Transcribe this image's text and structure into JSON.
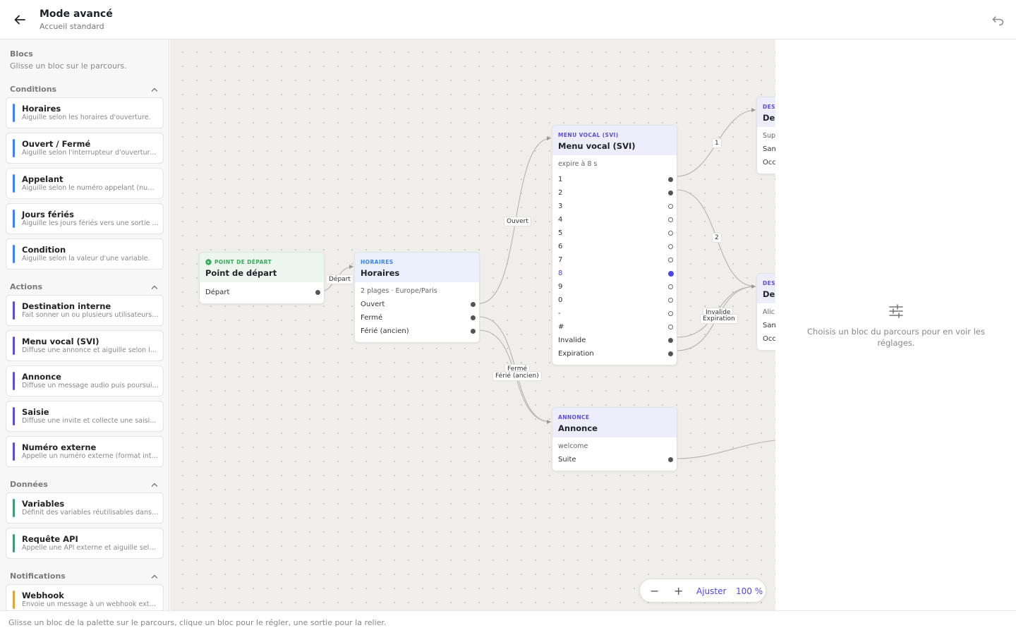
{
  "header": {
    "title": "Mode avancé",
    "subtitle": "Accueil standard"
  },
  "sidebar": {
    "title": "Blocs",
    "subtitle": "Glisse un bloc sur le parcours.",
    "sections": [
      {
        "label": "Conditions",
        "color": "#3b82f6",
        "items": [
          {
            "title": "Horaires",
            "desc": "Aiguille selon les horaires d'ouverture."
          },
          {
            "title": "Ouvert / Fermé",
            "desc": "Aiguille selon l'interrupteur d'ouverture manuel."
          },
          {
            "title": "Appelant",
            "desc": "Aiguille selon le numéro appelant (numéro ou préfixe)."
          },
          {
            "title": "Jours fériés",
            "desc": "Aiguille les jours fériés vers une sortie dédiée."
          },
          {
            "title": "Condition",
            "desc": "Aiguille selon la valeur d'une variable."
          }
        ]
      },
      {
        "label": "Actions",
        "color": "#5b4fd6",
        "items": [
          {
            "title": "Destination interne",
            "desc": "Fait sonner un ou plusieurs utilisateurs ou groupes."
          },
          {
            "title": "Menu vocal (SVI)",
            "desc": "Diffuse une annonce et aiguille selon la touche."
          },
          {
            "title": "Annonce",
            "desc": "Diffuse un message audio puis poursuit le parcours."
          },
          {
            "title": "Saisie",
            "desc": "Diffuse une invite et collecte une saisie clavier."
          },
          {
            "title": "Numéro externe",
            "desc": "Appelle un numéro externe (format international)."
          }
        ]
      },
      {
        "label": "Données",
        "color": "#3d9a7c",
        "items": [
          {
            "title": "Variables",
            "desc": "Définit des variables réutilisables dans le parcours."
          },
          {
            "title": "Requête API",
            "desc": "Appelle une API externe et aiguille selon la réponse."
          }
        ]
      },
      {
        "label": "Notifications",
        "color": "#e5a23a",
        "items": [
          {
            "title": "Webhook",
            "desc": "Envoie un message à un webhook externe."
          }
        ]
      }
    ]
  },
  "canvas": {
    "nodes": {
      "start": {
        "kind": "POINT DE DÉPART",
        "title": "Point de départ",
        "outputs": [
          "Départ"
        ],
        "kind_color": "#3aaa5c"
      },
      "hours": {
        "kind": "HORAIRES",
        "title": "Horaires",
        "meta": "2 plages · Europe/Paris",
        "outputs": [
          "Ouvert",
          "Fermé",
          "Férié (ancien)"
        ],
        "kind_color": "#3b82f6"
      },
      "ivr": {
        "kind": "MENU VOCAL (SVI)",
        "title": "Menu vocal (SVI)",
        "meta": "expire à 8 s",
        "outputs": [
          "1",
          "2",
          "3",
          "4",
          "5",
          "6",
          "7",
          "8",
          "9",
          "0",
          "-",
          "#",
          "Invalide",
          "Expiration"
        ],
        "kind_color": "#5b4fd6"
      },
      "announce": {
        "kind": "ANNONCE",
        "title": "Annonce",
        "meta": "welcome",
        "outputs": [
          "Suite"
        ],
        "kind_color": "#5b4fd6"
      },
      "dest1": {
        "kind": "DEST",
        "title": "Des",
        "rows": [
          "Supp",
          "San",
          "Occ"
        ]
      },
      "dest2": {
        "kind": "DEST",
        "title": "Des",
        "rows": [
          "Alic",
          "San",
          "Occ"
        ]
      }
    },
    "edge_labels": {
      "depart": "Départ",
      "ouvert": "Ouvert",
      "ferme": "Fermé",
      "ferie": "Férié (ancien)",
      "one": "1",
      "two": "2",
      "invalide": "Invalide",
      "expiration": "Expiration"
    },
    "zoom": {
      "minus": "−",
      "plus": "+",
      "fit": "Ajuster",
      "level": "100 %"
    }
  },
  "panel": {
    "empty_text": "Choisis un bloc du parcours pour en voir les réglages."
  },
  "footer": {
    "hint": "Glisse un bloc de la palette sur le parcours, clique un bloc pour le régler, une sortie pour la relier."
  },
  "colors": {
    "accent": "#4f46e5",
    "condition": "#3b82f6",
    "action": "#5b4fd6",
    "data": "#3d9a7c",
    "notification": "#e5a23a"
  }
}
